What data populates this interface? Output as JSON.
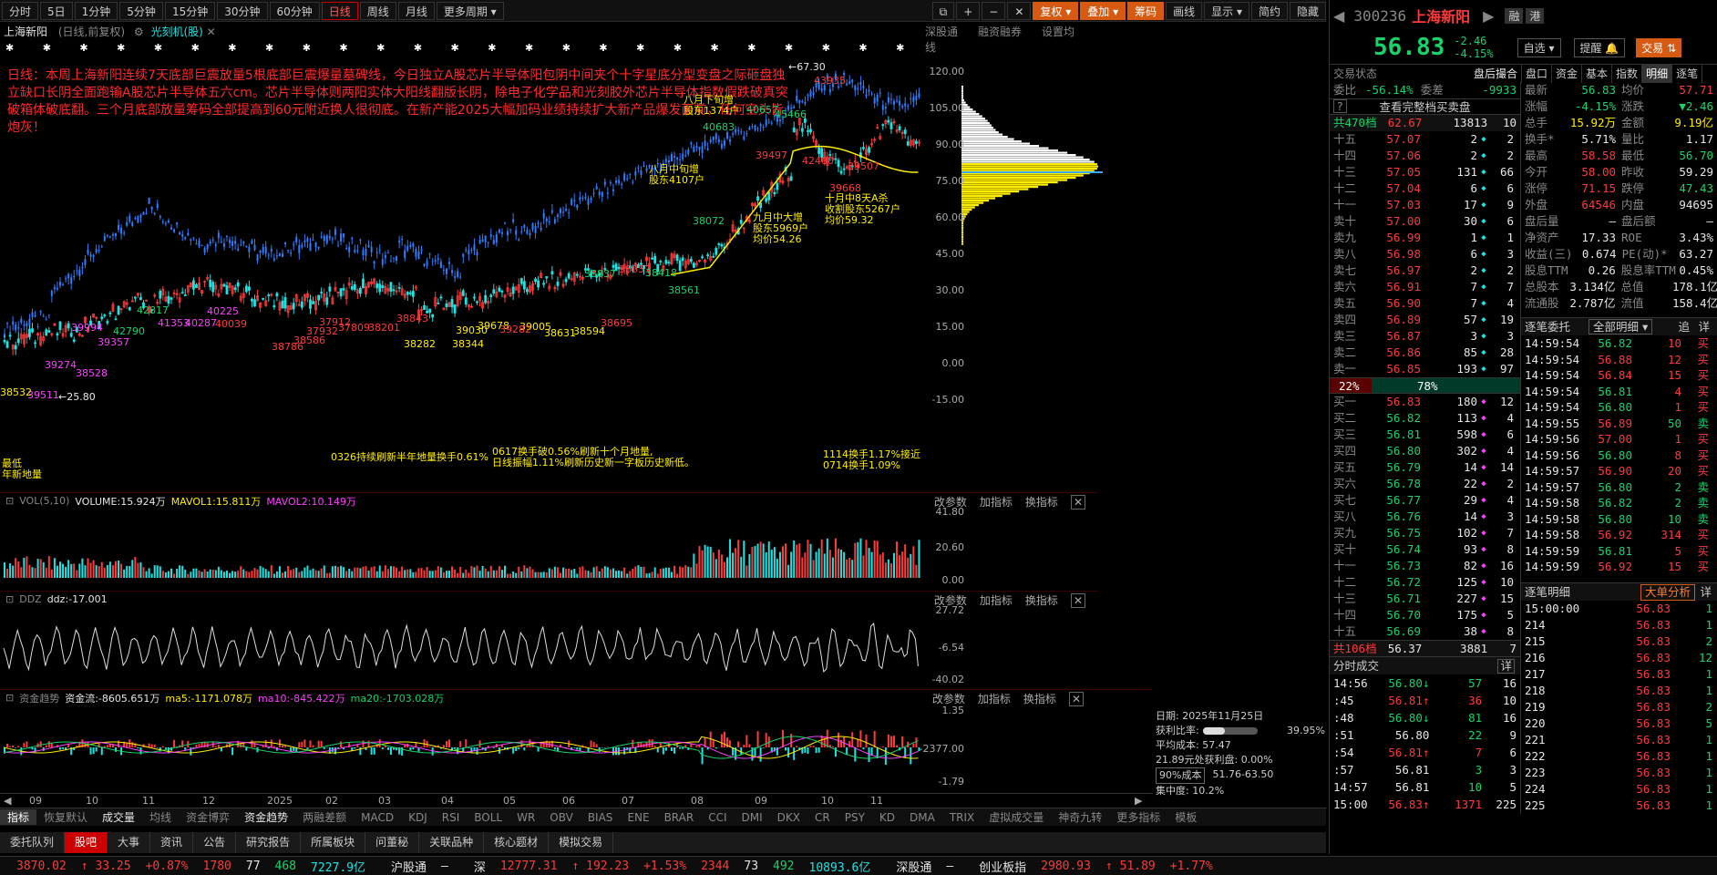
{
  "toolbar": {
    "periods": [
      "分时",
      "5日",
      "1分钟",
      "5分钟",
      "15分钟",
      "30分钟",
      "60分钟",
      "日线",
      "周线",
      "月线",
      "更多周期"
    ],
    "right": [
      "复权",
      "叠加",
      "筹码",
      "画线",
      "显示",
      "简约",
      "隐藏"
    ]
  },
  "chart": {
    "title": "上海新阳",
    "subtitle": "(日线,前复权)",
    "indicator": "光刻机(股)",
    "tabs": [
      "深股通",
      "融资融券",
      "设置均线"
    ],
    "annotation": "日线：本周上海新阳连续7天底部巨震放量5根底部巨震爆量墓碑线，今日独立A股芯片半导体阳包阴中间夹个十字星底分型变盘之际砸盘独立缺口长阴全面跑输A股芯片半导体五六cm。芯片半导体则两阳实体大阳线翻版长阴，除电子化学品和光刻胶外芯片半导体指数假跌破真突破箱体破底翻。三个月底部放量筹码全部提高到60元附近换人很彻底。在新产能2025大幅加码业绩持续扩大新产品爆发面前，任何空头皆炮灰！",
    "price_axis": [
      "120.00",
      "105.00",
      "90.00",
      "75.00",
      "60.00",
      "45.00",
      "30.00",
      "15.00",
      "0.00",
      "-15.00"
    ],
    "price_labels": [
      {
        "t": "67.30",
        "c": "wht"
      },
      {
        "t": "25.80",
        "c": "wht"
      },
      {
        "t": "40683",
        "c": "grn"
      },
      {
        "t": "40657",
        "c": "grn"
      },
      {
        "t": "45466",
        "c": "grn"
      },
      {
        "t": "39497",
        "c": "red"
      },
      {
        "t": "42400",
        "c": "red"
      },
      {
        "t": "39507",
        "c": "red"
      },
      {
        "t": "39668",
        "c": "red"
      },
      {
        "t": "43935",
        "c": "red"
      },
      {
        "t": "38837",
        "c": "grn"
      },
      {
        "t": "38037",
        "c": "red"
      },
      {
        "t": "38418",
        "c": "grn"
      },
      {
        "t": "38561",
        "c": "grn"
      },
      {
        "t": "38695",
        "c": "red"
      },
      {
        "t": "38072",
        "c": "grn"
      },
      {
        "t": "42817",
        "c": "grn"
      },
      {
        "t": "42790",
        "c": "grn"
      },
      {
        "t": "39357",
        "c": "mag"
      },
      {
        "t": "39994",
        "c": "mag"
      },
      {
        "t": "41353",
        "c": "mag"
      },
      {
        "t": "40287",
        "c": "mag"
      },
      {
        "t": "40225",
        "c": "mag"
      },
      {
        "t": "40039",
        "c": "red"
      },
      {
        "t": "38786",
        "c": "red"
      },
      {
        "t": "38586",
        "c": "red"
      },
      {
        "t": "37932",
        "c": "red"
      },
      {
        "t": "37912",
        "c": "red"
      },
      {
        "t": "37809",
        "c": "red"
      },
      {
        "t": "38201",
        "c": "red"
      },
      {
        "t": "38282",
        "c": "yel"
      },
      {
        "t": "38344",
        "c": "yel"
      },
      {
        "t": "39030",
        "c": "yel"
      },
      {
        "t": "39678",
        "c": "yel"
      },
      {
        "t": "39005",
        "c": "yel"
      },
      {
        "t": "38631",
        "c": "yel"
      },
      {
        "t": "38594",
        "c": "yel"
      },
      {
        "t": "38528",
        "c": "mag"
      },
      {
        "t": "39274",
        "c": "mag"
      },
      {
        "t": "39511",
        "c": "mag"
      },
      {
        "t": "38532",
        "c": "yel"
      },
      {
        "t": "39282",
        "c": "red"
      },
      {
        "t": "38843",
        "c": "red"
      }
    ],
    "notes": [
      {
        "t": "八月下旬增\n股东1374户",
        "c": "yel"
      },
      {
        "t": "八月中旬增\n股东4107户",
        "c": "yel"
      },
      {
        "t": "九月中大增\n股东5969户\n均价54.26",
        "c": "yel"
      },
      {
        "t": "十月中8天A杀\n收割股东5267户\n均价59.32",
        "c": "yel"
      }
    ],
    "dates": [
      "09",
      "10",
      "11",
      "12",
      "2025",
      "02",
      "03",
      "04",
      "05",
      "06",
      "07",
      "08",
      "09",
      "10",
      "11"
    ],
    "vol": {
      "name": "VOL(5,10)",
      "v": "VOLUME:15.924万",
      "m1": "MAVOL1:15.811万",
      "m2": "MAVOL2:10.149万",
      "axis": [
        "41.80",
        "20.60",
        "0.00"
      ],
      "notes": [
        "最低\n年新地量",
        "0326持续刷新半年地量换手0.61%",
        "0617换手破0.56%刷新十个月地量,\n日线振幅1.11%刷新历史新一字板历史新低。",
        "1114换手1.17%接近\n0714换手1.09%"
      ]
    },
    "ddz": {
      "name": "DDZ",
      "v": "ddz:-17.001",
      "axis": [
        "27.72",
        "-6.54",
        "-40.02"
      ]
    },
    "zj": {
      "name": "资金趋势",
      "v": "资金流:-8605.651万",
      "ma5": "ma5:-1171.078万",
      "ma10": "ma10:-845.422万",
      "ma20": "ma20:-1703.028万",
      "axis": [
        "1.35",
        "-2377.00",
        "-1.79"
      ]
    },
    "pbtns": [
      "改参数",
      "加指标",
      "换指标"
    ],
    "cost": {
      "date": "日期: 2025年11月25日",
      "profit_label": "获利比率:",
      "profit": "39.95%",
      "avg": "平均成本: 57.47",
      "lose": "21.89元处获利盘: 0.00%",
      "pct": "90%成本",
      "range": "51.76-63.50",
      "conc": "集中度: 10.2%"
    }
  },
  "bottom1": [
    "指标",
    "恢复默认",
    "成交量",
    "均线",
    "资金博弈",
    "资金趋势",
    "两融差额",
    "MACD",
    "KDJ",
    "RSI",
    "BOLL",
    "WR",
    "OBV",
    "BIAS",
    "ENE",
    "BRAR",
    "CCI",
    "DMI",
    "DKX",
    "CR",
    "PSY",
    "KD",
    "DMA",
    "TRIX",
    "虚拟成交量",
    "神奇九转",
    "更多指标",
    "模板"
  ],
  "bottom2": [
    "委托队列",
    "股吧",
    "大事",
    "资讯",
    "公告",
    "研究报告",
    "所属板块",
    "问董秘",
    "关联品种",
    "核心题材",
    "模拟交易"
  ],
  "status": [
    {
      "t": "3870.02",
      "c": "red"
    },
    {
      "t": "↑ 33.25",
      "c": "red"
    },
    {
      "t": "+0.87%",
      "c": "red"
    },
    {
      "t": "1780",
      "c": "red"
    },
    {
      "t": "77",
      "c": "wht"
    },
    {
      "t": "468",
      "c": "grn"
    },
    {
      "t": "7227.9亿",
      "c": "cyan"
    },
    {
      "t": "沪股通",
      "c": "wht"
    },
    {
      "t": "—",
      "c": "wht"
    },
    {
      "t": "深",
      "c": "wht"
    },
    {
      "t": "12777.31",
      "c": "red"
    },
    {
      "t": "↑ 192.23",
      "c": "red"
    },
    {
      "t": "+1.53%",
      "c": "red"
    },
    {
      "t": "2344",
      "c": "red"
    },
    {
      "t": "73",
      "c": "wht"
    },
    {
      "t": "492",
      "c": "grn"
    },
    {
      "t": "10893.6亿",
      "c": "cyan"
    },
    {
      "t": "深股通",
      "c": "wht"
    },
    {
      "t": "—",
      "c": "wht"
    },
    {
      "t": "创业板指",
      "c": "wht"
    },
    {
      "t": "2980.93",
      "c": "red"
    },
    {
      "t": "↑ 51.89",
      "c": "red"
    },
    {
      "t": "+1.77%",
      "c": "red"
    }
  ],
  "quote": {
    "code": "300236",
    "name": "上海新阳",
    "tags": [
      "融",
      "港"
    ],
    "price": "56.83",
    "chg": "-2.46",
    "pct": "-4.15%",
    "btns": [
      "自选",
      "提醒",
      "交易"
    ],
    "status_label": "交易状态",
    "after": "盘后撮合",
    "tabs": [
      "盘口",
      "资金",
      "基本",
      "指数",
      "明细",
      "逐笔"
    ],
    "wb": "委比",
    "wbv": "-56.14%",
    "wc": "委差",
    "wcv": "-9933",
    "all_btn": "查看完整档买卖盘",
    "sell_total": {
      "l": "共470档",
      "p": "62.67",
      "v": "13813",
      "n": "10"
    },
    "sells": [
      [
        "十五",
        "57.07",
        "2",
        "2"
      ],
      [
        "十四",
        "57.06",
        "2",
        "2"
      ],
      [
        "十三",
        "57.05",
        "131",
        "66"
      ],
      [
        "十二",
        "57.04",
        "6",
        "6"
      ],
      [
        "十一",
        "57.03",
        "17",
        "9"
      ],
      [
        "卖十",
        "57.00",
        "30",
        "6"
      ],
      [
        "卖九",
        "56.99",
        "1",
        "1"
      ],
      [
        "卖八",
        "56.98",
        "6",
        "3"
      ],
      [
        "卖七",
        "56.97",
        "2",
        "2"
      ],
      [
        "卖六",
        "56.91",
        "7",
        "7"
      ],
      [
        "卖五",
        "56.90",
        "7",
        "4"
      ],
      [
        "卖四",
        "56.89",
        "57",
        "19"
      ],
      [
        "卖三",
        "56.87",
        "3",
        "3"
      ],
      [
        "卖二",
        "56.86",
        "85",
        "28"
      ],
      [
        "卖一",
        "56.85",
        "193",
        "97"
      ]
    ],
    "ratio": [
      "22%",
      "78%"
    ],
    "buys": [
      [
        "买一",
        "56.83",
        "180",
        "12"
      ],
      [
        "买二",
        "56.82",
        "113",
        "4"
      ],
      [
        "买三",
        "56.81",
        "598",
        "6"
      ],
      [
        "买四",
        "56.80",
        "302",
        "4"
      ],
      [
        "买五",
        "56.79",
        "14",
        "14"
      ],
      [
        "买六",
        "56.78",
        "22",
        "2"
      ],
      [
        "买七",
        "56.77",
        "29",
        "4"
      ],
      [
        "买八",
        "56.76",
        "14",
        "3"
      ],
      [
        "买九",
        "56.75",
        "102",
        "7"
      ],
      [
        "买十",
        "56.74",
        "93",
        "8"
      ],
      [
        "十一",
        "56.73",
        "82",
        "16"
      ],
      [
        "十二",
        "56.72",
        "125",
        "10"
      ],
      [
        "十三",
        "56.71",
        "227",
        "15"
      ],
      [
        "十四",
        "56.70",
        "175",
        "5"
      ],
      [
        "十五",
        "56.69",
        "38",
        "8"
      ]
    ],
    "buy_total": {
      "l": "共106档",
      "p": "56.37",
      "v": "3881",
      "n": "7"
    },
    "stats": [
      [
        "最新",
        "56.83",
        "均价",
        "57.71"
      ],
      [
        "涨幅",
        "-4.15%",
        "涨跌",
        "▼2.46"
      ],
      [
        "总手",
        "15.92万",
        "金额",
        "9.19亿"
      ],
      [
        "换手*",
        "5.71%",
        "量比",
        "1.17"
      ],
      [
        "最高",
        "58.58",
        "最低",
        "56.70"
      ],
      [
        "今开",
        "58.00",
        "昨收",
        "59.29"
      ],
      [
        "涨停",
        "71.15",
        "跌停",
        "47.43"
      ],
      [
        "外盘",
        "64546",
        "内盘",
        "94695"
      ],
      [
        "盘后量",
        "—",
        "盘后额",
        "—"
      ],
      [
        "净资产",
        "17.33",
        "ROE",
        "3.43%"
      ],
      [
        "收益(三)",
        "0.674",
        "PE(动)*",
        "63.27"
      ],
      [
        "股息TTM",
        "0.26",
        "股息率TTM",
        "0.45%"
      ],
      [
        "总股本",
        "3.134亿",
        "总值",
        "178.1亿"
      ],
      [
        "流通股",
        "2.787亿",
        "流值",
        "158.4亿"
      ]
    ],
    "zb_title": "逐笔委托",
    "zb_sel": "全部明细",
    "zb_btns": [
      "追",
      "详"
    ],
    "zb": [
      [
        "14:59:54",
        "56.82",
        "10",
        "买"
      ],
      [
        "14:59:54",
        "56.88",
        "12",
        "买"
      ],
      [
        "14:59:54",
        "56.84",
        "15",
        "买"
      ],
      [
        "14:59:54",
        "56.81",
        "4",
        "买"
      ],
      [
        "14:59:54",
        "56.80",
        "1",
        "买"
      ],
      [
        "14:59:55",
        "56.89",
        "50",
        "卖"
      ],
      [
        "14:59:56",
        "57.00",
        "1",
        "买"
      ],
      [
        "14:59:56",
        "56.80",
        "8",
        "买"
      ],
      [
        "14:59:57",
        "56.90",
        "20",
        "买"
      ],
      [
        "14:59:57",
        "56.80",
        "2",
        "卖"
      ],
      [
        "14:59:58",
        "56.82",
        "2",
        "卖"
      ],
      [
        "14:59:58",
        "56.80",
        "10",
        "卖"
      ],
      [
        "14:59:58",
        "56.92",
        "314",
        "买"
      ],
      [
        "14:59:59",
        "56.81",
        "5",
        "买"
      ],
      [
        "14:59:59",
        "56.92",
        "15",
        "买"
      ]
    ],
    "zbmx_title": "逐笔明细",
    "zbmx_btn": "大单分析",
    "zbmx_d": "详",
    "zbmx": [
      [
        "15:00:00",
        "56.83",
        "1"
      ],
      [
        "214",
        "56.83",
        "1"
      ],
      [
        "215",
        "56.83",
        "2"
      ],
      [
        "216",
        "56.83",
        "12"
      ],
      [
        "217",
        "56.83",
        "1"
      ],
      [
        "218",
        "56.83",
        "1"
      ],
      [
        "219",
        "56.83",
        "2"
      ],
      [
        "220",
        "56.83",
        "5"
      ],
      [
        "221",
        "56.83",
        "1"
      ],
      [
        "222",
        "56.83",
        "1"
      ],
      [
        "223",
        "56.83",
        "1"
      ],
      [
        "224",
        "56.83",
        "1"
      ],
      [
        "225",
        "56.83",
        "1"
      ]
    ],
    "fs_title": "分时成交",
    "fs_d": "详",
    "fs": [
      [
        "14:56",
        "56.80↓",
        "57",
        "16"
      ],
      [
        ":45",
        "56.81↑",
        "36",
        "10"
      ],
      [
        ":48",
        "56.80↓",
        "81",
        "16"
      ],
      [
        ":51",
        "56.80",
        "22",
        "9"
      ],
      [
        ":54",
        "56.81↑",
        "7",
        "6"
      ],
      [
        ":57",
        "56.81",
        "3",
        "3"
      ],
      [
        "14:57",
        "56.81",
        "10",
        "5"
      ],
      [
        "15:00",
        "56.83↑",
        "1371",
        "225"
      ]
    ]
  }
}
